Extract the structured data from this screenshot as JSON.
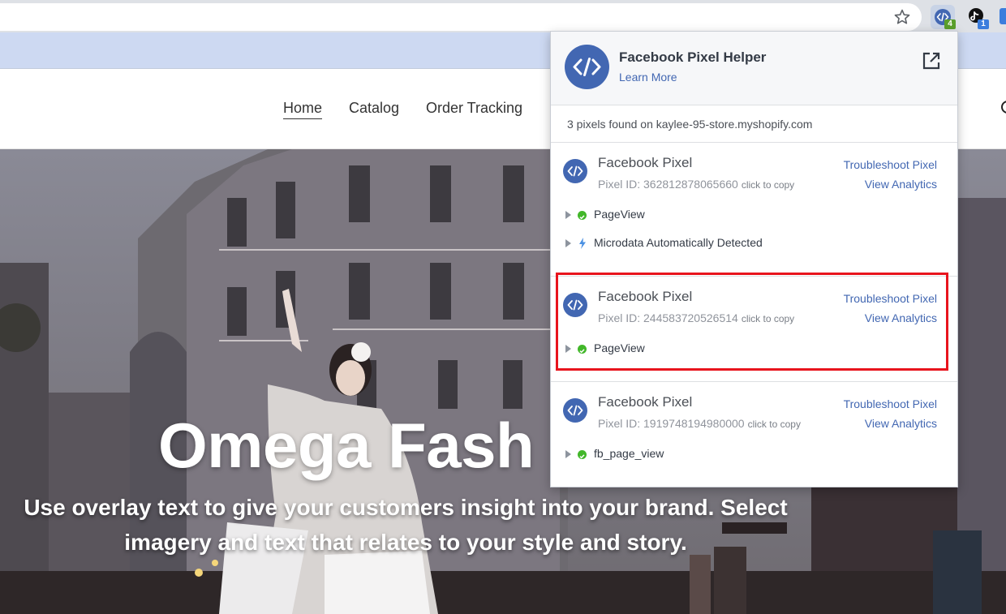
{
  "colors": {
    "facebook_blue": "#4267b2",
    "highlight_red": "#e8141d",
    "success_green": "#42b72a"
  },
  "browser": {
    "extensions": [
      {
        "name": "facebook-pixel-helper",
        "badge": "4"
      },
      {
        "name": "tiktok-pixel-helper",
        "badge": "1"
      }
    ]
  },
  "store": {
    "nav": [
      "Home",
      "Catalog",
      "Order Tracking"
    ],
    "hero_title": "Omega Fash",
    "hero_subtitle_line1": "Use overlay text to give your customers insight into your brand. Select",
    "hero_subtitle_line2": "imagery and text that relates to your style and story."
  },
  "popup": {
    "title": "Facebook Pixel Helper",
    "learn_more": "Learn More",
    "found_text": "3 pixels found on kaylee-95-store.myshopify.com",
    "pixels": [
      {
        "name": "Facebook Pixel",
        "id_label": "Pixel ID: 362812878065660",
        "copy": "click to copy",
        "troubleshoot": "Troubleshoot Pixel",
        "analytics": "View Analytics",
        "events": [
          {
            "label": "PageView",
            "status": "success"
          },
          {
            "label": "Microdata Automatically Detected",
            "status": "info"
          }
        ]
      },
      {
        "name": "Facebook Pixel",
        "id_label": "Pixel ID: 244583720526514",
        "copy": "click to copy",
        "troubleshoot": "Troubleshoot Pixel",
        "analytics": "View Analytics",
        "highlighted": true,
        "events": [
          {
            "label": "PageView",
            "status": "success"
          }
        ]
      },
      {
        "name": "Facebook Pixel",
        "id_label": "Pixel ID: 1919748194980000",
        "copy": "click to copy",
        "troubleshoot": "Troubleshoot Pixel",
        "analytics": "View Analytics",
        "events": [
          {
            "label": "fb_page_view",
            "status": "success"
          }
        ]
      }
    ]
  }
}
